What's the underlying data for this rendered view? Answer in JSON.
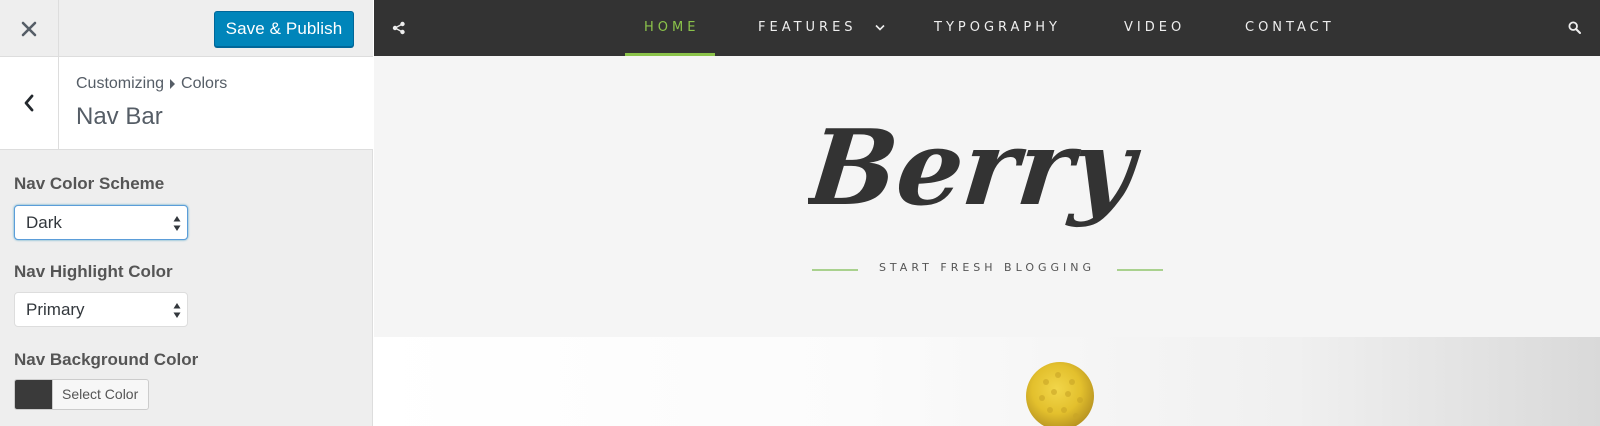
{
  "customizer": {
    "save_label": "Save & Publish",
    "breadcrumb": {
      "root": "Customizing",
      "parent": "Colors"
    },
    "section_title": "Nav Bar",
    "controls": {
      "scheme": {
        "label": "Nav Color Scheme",
        "value": "Dark"
      },
      "highlight": {
        "label": "Nav Highlight Color",
        "value": "Primary"
      },
      "background": {
        "label": "Nav Background Color",
        "button": "Select Color",
        "swatch": "#3a3a3a"
      }
    },
    "icons": {
      "close": "close-icon",
      "back": "chevron-left-icon",
      "select_arrows": "updown-arrows-icon"
    }
  },
  "preview": {
    "nav": {
      "items": [
        {
          "label": "HOME",
          "active": true
        },
        {
          "label": "FEATURES",
          "has_dropdown": true
        },
        {
          "label": "TYPOGRAPHY"
        },
        {
          "label": "VIDEO"
        },
        {
          "label": "CONTACT"
        }
      ],
      "icons": {
        "left": "share-icon",
        "right": "search-icon",
        "dropdown": "chevron-down-icon"
      }
    },
    "site_title": "Berry",
    "tagline": "START FRESH BLOGGING"
  },
  "colors": {
    "accent": "#0085ba",
    "nav_bg": "#333333",
    "nav_highlight": "#8bc34a",
    "tagline_rule": "#a9d18e",
    "sidebar_bg": "#eeeeee"
  }
}
